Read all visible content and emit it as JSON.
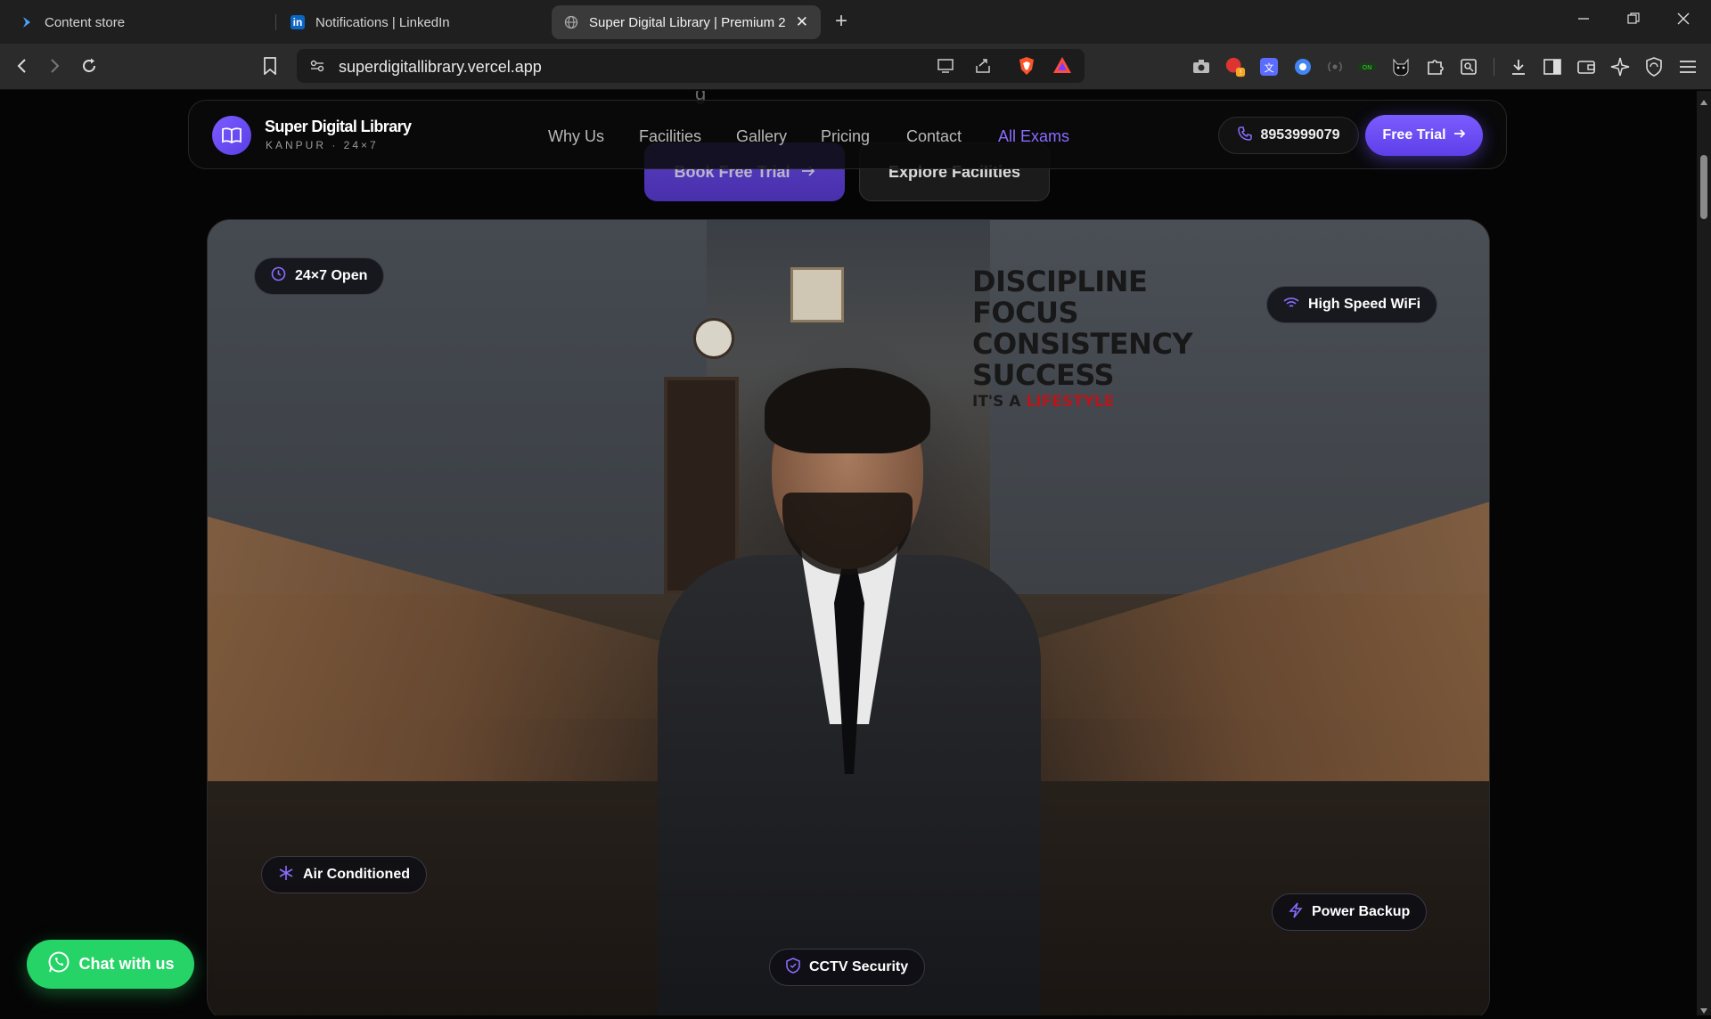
{
  "browser": {
    "tabs": [
      {
        "label": "Content store",
        "icon": "content-store-icon"
      },
      {
        "label": "Notifications | LinkedIn",
        "icon": "linkedin-icon"
      },
      {
        "label": "Super Digital Library | Premium 2",
        "icon": "globe-icon",
        "active": true
      }
    ],
    "url": "superdigitallibrary.vercel.app"
  },
  "page": {
    "ghost_heading": "g",
    "hero_buttons": {
      "book_trial": "Book Free Trial",
      "explore": "Explore Facilities"
    },
    "navbar": {
      "brand_name": "Super Digital Library",
      "brand_sub": "KANPUR · 24×7",
      "links": [
        "Why Us",
        "Facilities",
        "Gallery",
        "Pricing",
        "Contact",
        "All Exams"
      ],
      "phone": "8953999079",
      "cta": "Free Trial",
      "accent_color": "#7b5cff"
    },
    "hero_image": {
      "slogan": [
        "DISCIPLINE",
        "FOCUS",
        "CONSISTENCY",
        "SUCCESS"
      ],
      "tagline_prefix": "IT'S A",
      "tagline_highlight": "LIFESTYLE"
    },
    "chips": {
      "open": "24×7 Open",
      "wifi": "High Speed WiFi",
      "ac": "Air Conditioned",
      "power": "Power Backup",
      "cctv": "CCTV Security"
    },
    "whatsapp": "Chat with us"
  }
}
